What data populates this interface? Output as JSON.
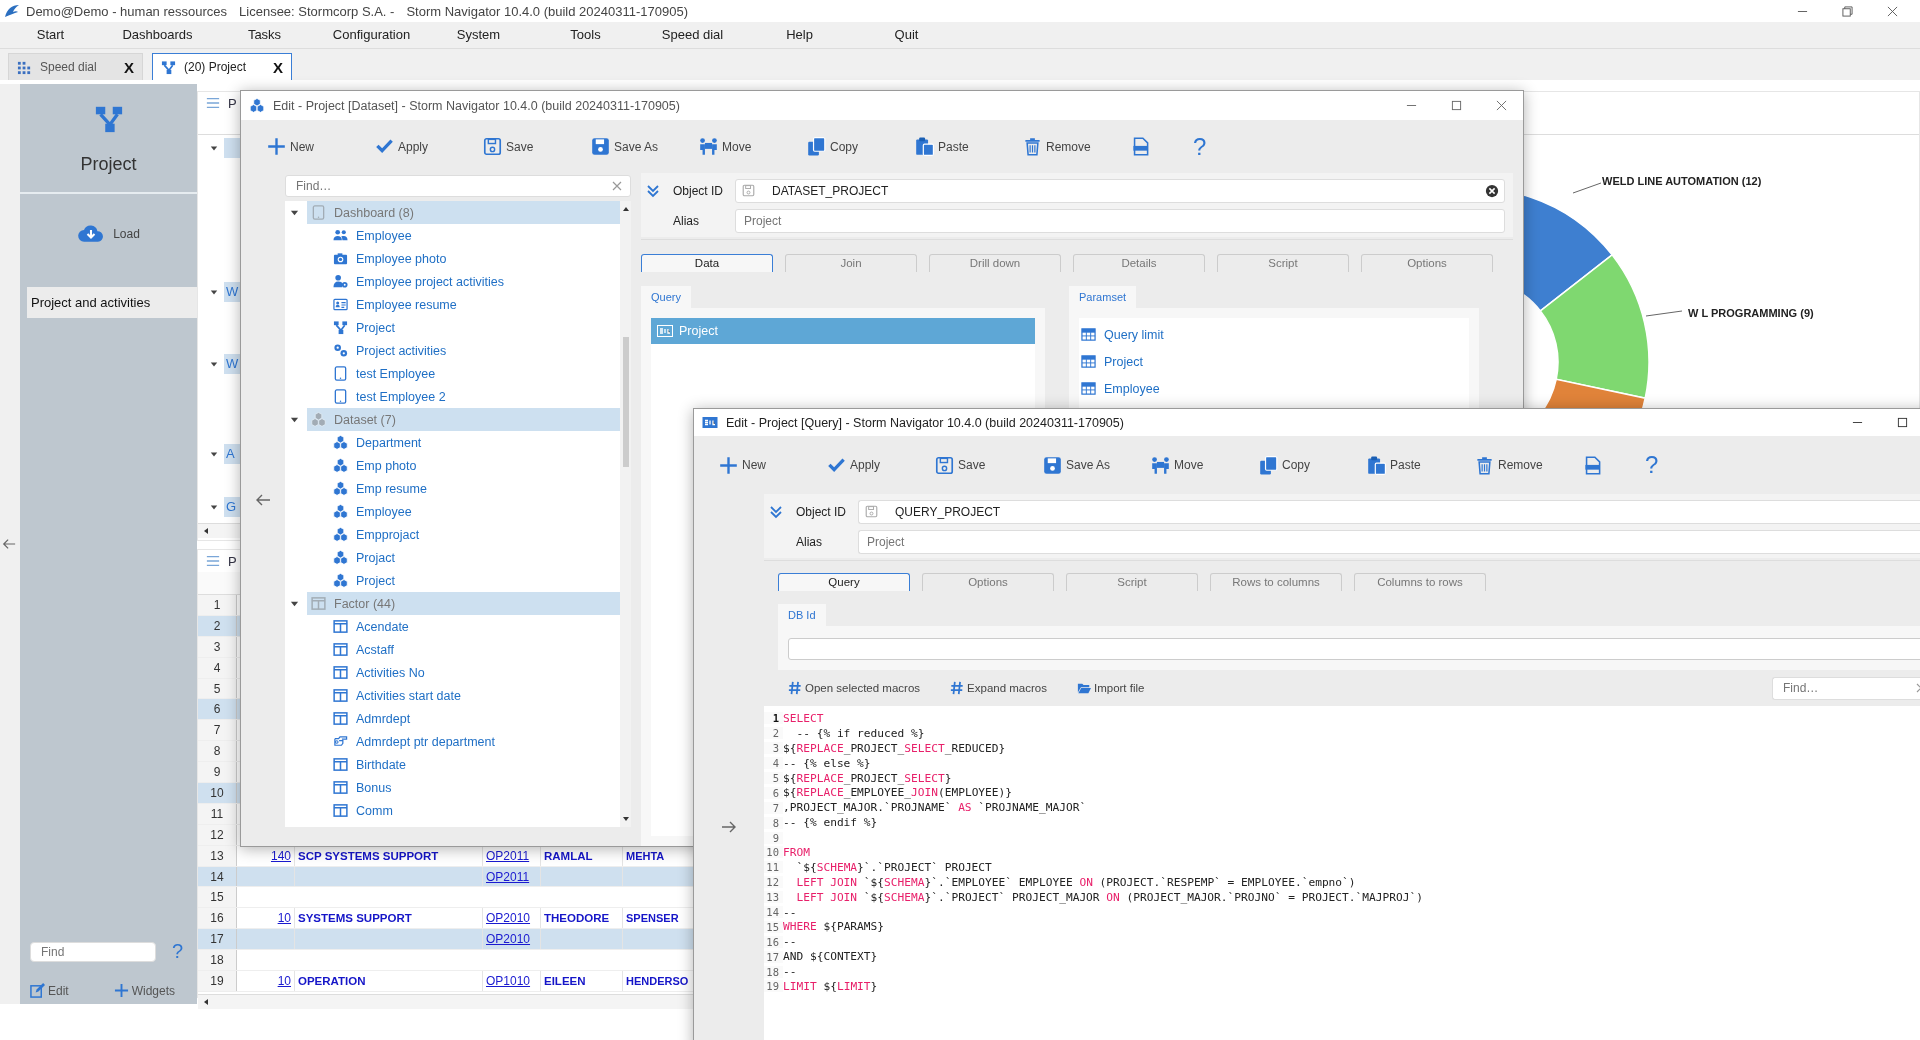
{
  "window": {
    "title_parts": [
      "Demo@Demo - human ressources",
      "Licensee: Stormcorp S.A. -",
      "Storm Navigator 10.4.0 (build 20240311-170905)"
    ]
  },
  "menu": [
    "Start",
    "Dashboards",
    "Tasks",
    "Configuration",
    "System",
    "Tools",
    "Speed dial",
    "Help",
    "Quit"
  ],
  "tabs": [
    {
      "label": "Speed dial",
      "kind": "speed",
      "selected": false,
      "close": "X"
    },
    {
      "label": "(20) Project",
      "kind": "project",
      "selected": true,
      "close": "X"
    }
  ],
  "sidebar": {
    "title": "Project",
    "load": "Load",
    "items": [
      {
        "label": "Project and activities",
        "selected": true
      }
    ],
    "find_placeholder": "Find",
    "help": "?",
    "edit": "Edit",
    "widgets": "Widgets"
  },
  "background": {
    "top_panel_title": "P",
    "groups": [
      {
        "expanded": true
      },
      {
        "label": "W",
        "expanded": true
      },
      {
        "label": "W",
        "expanded": true
      },
      {
        "label": "A",
        "expanded": true
      },
      {
        "label": "G",
        "expanded": true
      }
    ],
    "bottom_panel_title": "P",
    "rows": [
      {
        "number": "1",
        "selected": false
      },
      {
        "number": "2",
        "selected": true
      },
      {
        "number": "3",
        "selected": false
      },
      {
        "number": "4",
        "selected": false
      },
      {
        "number": "5",
        "selected": false
      },
      {
        "number": "6",
        "selected": true
      },
      {
        "number": "7",
        "selected": false
      },
      {
        "number": "8",
        "selected": false
      },
      {
        "number": "9",
        "selected": false
      },
      {
        "number": "10",
        "selected": true
      },
      {
        "number": "11",
        "selected": false
      },
      {
        "number": "12",
        "selected": false
      },
      {
        "number": "13",
        "selected": false,
        "cells": [
          "140",
          "SCP SYSTEMS SUPPORT",
          "OP2011",
          "RAMLAL",
          "MEHTA"
        ]
      },
      {
        "number": "14",
        "selected": true,
        "cells": [
          "",
          "",
          "OP2011",
          "",
          ""
        ]
      },
      {
        "number": "15",
        "selected": false
      },
      {
        "number": "16",
        "selected": false,
        "cells": [
          "10",
          "SYSTEMS SUPPORT",
          "OP2010",
          "THEODORE",
          "SPENSER"
        ]
      },
      {
        "number": "17",
        "selected": true,
        "cells": [
          "",
          "",
          "OP2010",
          "",
          ""
        ]
      },
      {
        "number": "18",
        "selected": false
      },
      {
        "number": "19",
        "selected": false,
        "cells": [
          "10",
          "OPERATION",
          "OP1010",
          "EILEEN",
          "HENDERSO"
        ]
      }
    ],
    "donut_labels": [
      "WELD LINE AUTOMATION (12)",
      "W L PROGRAMMING (9)"
    ]
  },
  "dataset_window": {
    "title": "Edit - Project [Dataset] -  Storm Navigator 10.4.0 (build 20240311-170905)",
    "toolbar": [
      {
        "label": "New",
        "kind": "new"
      },
      {
        "label": "Apply",
        "kind": "check"
      },
      {
        "label": "Save",
        "kind": "save"
      },
      {
        "label": "Save As",
        "kind": "saveas"
      },
      {
        "label": "Move",
        "kind": "move"
      },
      {
        "label": "Copy",
        "kind": "copy"
      },
      {
        "label": "Paste",
        "kind": "paste"
      },
      {
        "label": "Remove",
        "kind": "remove"
      },
      {
        "kind": "xml"
      },
      {
        "label": "?",
        "kind": "help"
      }
    ],
    "find_placeholder": "Find…",
    "tree": [
      {
        "label": "Dashboard (8)",
        "kind": "tablet",
        "expanded": true,
        "children": [
          {
            "label": "Employee",
            "kind": "people"
          },
          {
            "label": "Employee photo",
            "kind": "camera"
          },
          {
            "label": "Employee project activities",
            "kind": "usergear"
          },
          {
            "label": "Employee resume",
            "kind": "idcard"
          },
          {
            "label": "Project",
            "kind": "project"
          },
          {
            "label": "Project activities",
            "kind": "gears"
          },
          {
            "label": "test Employee",
            "kind": "tablet"
          },
          {
            "label": "test Employee 2",
            "kind": "tablet"
          }
        ]
      },
      {
        "label": "Dataset (7)",
        "kind": "cubes",
        "expanded": true,
        "children": [
          {
            "label": "Department",
            "kind": "cubes"
          },
          {
            "label": "Emp photo",
            "kind": "cubes"
          },
          {
            "label": "Emp resume",
            "kind": "cubes"
          },
          {
            "label": "Employee",
            "kind": "cubes"
          },
          {
            "label": "Empprojact",
            "kind": "cubes"
          },
          {
            "label": "Projact",
            "kind": "cubes"
          },
          {
            "label": "Project",
            "kind": "cubes"
          }
        ]
      },
      {
        "label": "Factor (44)",
        "kind": "columns",
        "expanded": true,
        "children": [
          {
            "label": "Acendate",
            "kind": "columns"
          },
          {
            "label": "Acstaff",
            "kind": "columns"
          },
          {
            "label": "Activities No",
            "kind": "columns"
          },
          {
            "label": "Activities start date",
            "kind": "columns"
          },
          {
            "label": "Admrdept",
            "kind": "columns"
          },
          {
            "label": "Admrdept ptr department",
            "kind": "pointer"
          },
          {
            "label": "Birthdate",
            "kind": "columns"
          },
          {
            "label": "Bonus",
            "kind": "columns"
          },
          {
            "label": "Comm",
            "kind": "columns"
          }
        ]
      }
    ],
    "fields": [
      {
        "label": "Object ID",
        "value": "DATASET_PROJECT"
      },
      {
        "label": "Alias",
        "placeholder": "Project"
      }
    ],
    "tabs": [
      {
        "label": "Data",
        "selected": true
      },
      {
        "label": "Join",
        "selected": false
      },
      {
        "label": "Drill down",
        "selected": false
      },
      {
        "label": "Details",
        "selected": false
      },
      {
        "label": "Script",
        "selected": false
      },
      {
        "label": "Options",
        "selected": false
      }
    ],
    "query_tab": "Query",
    "query_items": [
      {
        "label": "Project",
        "selected": true
      }
    ],
    "paramset_tab": "Paramset",
    "paramset_items": [
      "Query limit",
      "Project",
      "Employee"
    ]
  },
  "query_window": {
    "title": "Edit - Project [Query] -  Storm Navigator 10.4.0 (build 20240311-170905)",
    "toolbar": [
      {
        "label": "New",
        "kind": "new"
      },
      {
        "label": "Apply",
        "kind": "check"
      },
      {
        "label": "Save",
        "kind": "save"
      },
      {
        "label": "Save As",
        "kind": "saveas"
      },
      {
        "label": "Move",
        "kind": "move"
      },
      {
        "label": "Copy",
        "kind": "copy"
      },
      {
        "label": "Paste",
        "kind": "paste"
      },
      {
        "label": "Remove",
        "kind": "remove"
      },
      {
        "kind": "xml"
      },
      {
        "label": "?",
        "kind": "help"
      }
    ],
    "fields": [
      {
        "label": "Object ID",
        "value": "QUERY_PROJECT"
      },
      {
        "label": "Alias",
        "placeholder": "Project"
      }
    ],
    "tabs": [
      {
        "label": "Query",
        "selected": true
      },
      {
        "label": "Options",
        "selected": false
      },
      {
        "label": "Script",
        "selected": false
      },
      {
        "label": "Rows to columns",
        "selected": false
      },
      {
        "label": "Columns to rows",
        "selected": false
      }
    ],
    "db_tab": "DB Id",
    "actions": [
      {
        "label": "Open selected macros",
        "kind": "hash"
      },
      {
        "label": "Expand macros",
        "kind": "hash"
      },
      {
        "label": "Import file",
        "kind": "folder"
      }
    ],
    "find_placeholder": "Find…",
    "code": [
      {
        "number": "1",
        "current": true,
        "tokens": [
          {
            "text": "SELECT",
            "kind": "keyword"
          }
        ]
      },
      {
        "number": "2",
        "current": false,
        "tokens": [
          {
            "text": "  -- {% if reduced %}",
            "kind": "plain"
          }
        ]
      },
      {
        "number": "3",
        "current": false,
        "tokens": [
          {
            "text": "${",
            "kind": "plain"
          },
          {
            "text": "REPLACE",
            "kind": "keyword"
          },
          {
            "text": "_PROJECT_",
            "kind": "plain"
          },
          {
            "text": "SELECT",
            "kind": "keyword"
          },
          {
            "text": "_REDUCED}",
            "kind": "plain"
          }
        ]
      },
      {
        "number": "4",
        "current": false,
        "tokens": [
          {
            "text": "-- {% else %}",
            "kind": "plain"
          }
        ]
      },
      {
        "number": "5",
        "current": false,
        "tokens": [
          {
            "text": "${",
            "kind": "plain"
          },
          {
            "text": "REPLACE",
            "kind": "keyword"
          },
          {
            "text": "_PROJECT_",
            "kind": "plain"
          },
          {
            "text": "SELECT",
            "kind": "keyword"
          },
          {
            "text": "}",
            "kind": "plain"
          }
        ]
      },
      {
        "number": "6",
        "current": false,
        "tokens": [
          {
            "text": "${",
            "kind": "plain"
          },
          {
            "text": "REPLACE",
            "kind": "keyword"
          },
          {
            "text": "_EMPLOYEE_",
            "kind": "plain"
          },
          {
            "text": "JOIN",
            "kind": "keyword"
          },
          {
            "text": "(EMPLOYEE)}",
            "kind": "plain"
          }
        ]
      },
      {
        "number": "7",
        "current": false,
        "tokens": [
          {
            "text": ",PROJECT_MAJOR.`PROJNAME` ",
            "kind": "plain"
          },
          {
            "text": "AS",
            "kind": "keyword"
          },
          {
            "text": " `PROJNAME_MAJOR`",
            "kind": "plain"
          }
        ]
      },
      {
        "number": "8",
        "current": false,
        "tokens": [
          {
            "text": "-- {% endif %}",
            "kind": "plain"
          }
        ]
      },
      {
        "number": "9",
        "current": false
      },
      {
        "number": "10",
        "current": false,
        "tokens": [
          {
            "text": "FROM",
            "kind": "keyword"
          }
        ]
      },
      {
        "number": "11",
        "current": false,
        "tokens": [
          {
            "text": "  `${",
            "kind": "plain"
          },
          {
            "text": "SCHEMA",
            "kind": "keyword"
          },
          {
            "text": "}`.`PROJECT` PROJECT",
            "kind": "plain"
          }
        ]
      },
      {
        "number": "12",
        "current": false,
        "tokens": [
          {
            "text": "  LEFT JOIN",
            "kind": "keyword"
          },
          {
            "text": " `${",
            "kind": "plain"
          },
          {
            "text": "SCHEMA",
            "kind": "keyword"
          },
          {
            "text": "}`.`EMPLOYEE` EMPLOYEE ",
            "kind": "plain"
          },
          {
            "text": "ON",
            "kind": "keyword"
          },
          {
            "text": " (PROJECT.`RESPEMP` = EMPLOYEE.`empno`)",
            "kind": "plain"
          }
        ]
      },
      {
        "number": "13",
        "current": false,
        "tokens": [
          {
            "text": "  LEFT JOIN",
            "kind": "keyword"
          },
          {
            "text": " `${",
            "kind": "plain"
          },
          {
            "text": "SCHEMA",
            "kind": "keyword"
          },
          {
            "text": "}`.`PROJECT` PROJECT_MAJOR ",
            "kind": "plain"
          },
          {
            "text": "ON",
            "kind": "keyword"
          },
          {
            "text": " (PROJECT_MAJOR.`PROJNO` = PROJECT.`MAJPROJ`)",
            "kind": "plain"
          }
        ]
      },
      {
        "number": "14",
        "current": false,
        "tokens": [
          {
            "text": "--",
            "kind": "plain"
          }
        ]
      },
      {
        "number": "15",
        "current": false,
        "tokens": [
          {
            "text": "WHERE",
            "kind": "keyword"
          },
          {
            "text": " ${PARAMS}",
            "kind": "plain"
          }
        ]
      },
      {
        "number": "16",
        "current": false,
        "tokens": [
          {
            "text": "--",
            "kind": "plain"
          }
        ]
      },
      {
        "number": "17",
        "current": false,
        "tokens": [
          {
            "text": "AND ${CONTEXT}",
            "kind": "plain"
          }
        ]
      },
      {
        "number": "18",
        "current": false,
        "tokens": [
          {
            "text": "--",
            "kind": "plain"
          }
        ]
      },
      {
        "number": "19",
        "current": false,
        "tokens": [
          {
            "text": "LIMIT",
            "kind": "keyword"
          },
          {
            "text": " ${",
            "kind": "plain"
          },
          {
            "text": "LIMIT",
            "kind": "keyword"
          },
          {
            "text": "}",
            "kind": "plain"
          }
        ]
      }
    ]
  }
}
